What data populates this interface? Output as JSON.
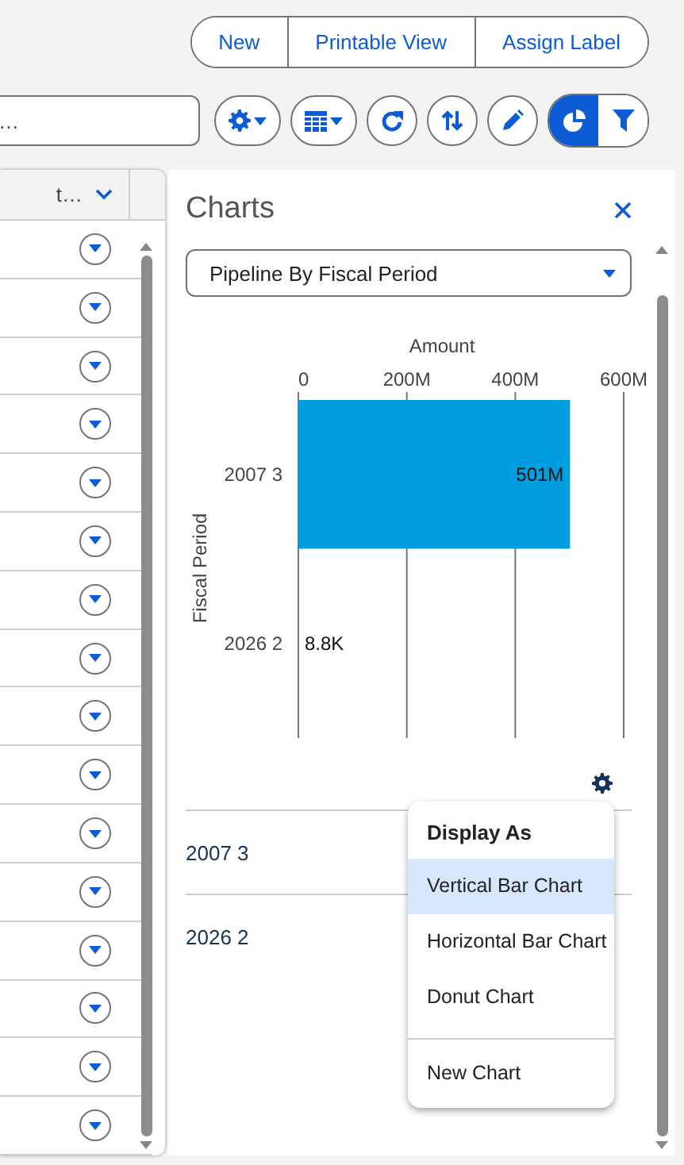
{
  "actions": [
    {
      "label": "New"
    },
    {
      "label": "Printable View"
    },
    {
      "label": "Assign Label"
    }
  ],
  "search": {
    "value": "…"
  },
  "toolbar": [
    {
      "kind": "gear-menu"
    },
    {
      "kind": "table-menu"
    },
    {
      "kind": "refresh"
    },
    {
      "kind": "sort"
    },
    {
      "kind": "edit"
    }
  ],
  "view_toggle": [
    {
      "kind": "chart",
      "selected": true
    },
    {
      "kind": "filter",
      "selected": false
    }
  ],
  "table": {
    "header": "t…",
    "rows": [
      {
        "kind": "action-row"
      },
      {
        "kind": "action-row"
      },
      {
        "kind": "action-row"
      },
      {
        "kind": "action-row"
      },
      {
        "kind": "action-row"
      },
      {
        "kind": "action-row"
      },
      {
        "kind": "action-row"
      },
      {
        "kind": "action-row"
      },
      {
        "kind": "action-row"
      },
      {
        "kind": "action-row"
      },
      {
        "kind": "action-row"
      },
      {
        "kind": "action-row"
      },
      {
        "kind": "action-row"
      },
      {
        "kind": "action-row"
      },
      {
        "kind": "action-row"
      },
      {
        "kind": "action-row"
      }
    ]
  },
  "charts_panel": {
    "title": "Charts",
    "selector": {
      "value": "Pipeline By Fiscal Period"
    },
    "chart_data": {
      "type": "bar",
      "orientation": "horizontal",
      "xlabel": "Amount",
      "ylabel": "Fiscal Period",
      "categories": [
        "2007 3",
        "2026 2"
      ],
      "values": [
        501000000,
        8800
      ],
      "xlim": [
        0,
        600000000
      ],
      "xticks": [
        {
          "value": 0,
          "label": "0"
        },
        {
          "value": 200000000,
          "label": "200M"
        },
        {
          "value": 400000000,
          "label": "400M"
        },
        {
          "value": 600000000,
          "label": "600M"
        }
      ],
      "value_labels": [
        "501M",
        "8.8K"
      ]
    },
    "rows": [
      {
        "label": "2007 3"
      },
      {
        "label": "2026 2"
      }
    ],
    "menu": {
      "heading": "Display As",
      "items": [
        {
          "label": "Vertical Bar Chart",
          "selected": true
        },
        {
          "label": "Horizontal Bar Chart",
          "selected": false
        },
        {
          "label": "Donut Chart",
          "selected": false
        }
      ],
      "footer_items": [
        {
          "label": "New Chart"
        }
      ]
    }
  }
}
